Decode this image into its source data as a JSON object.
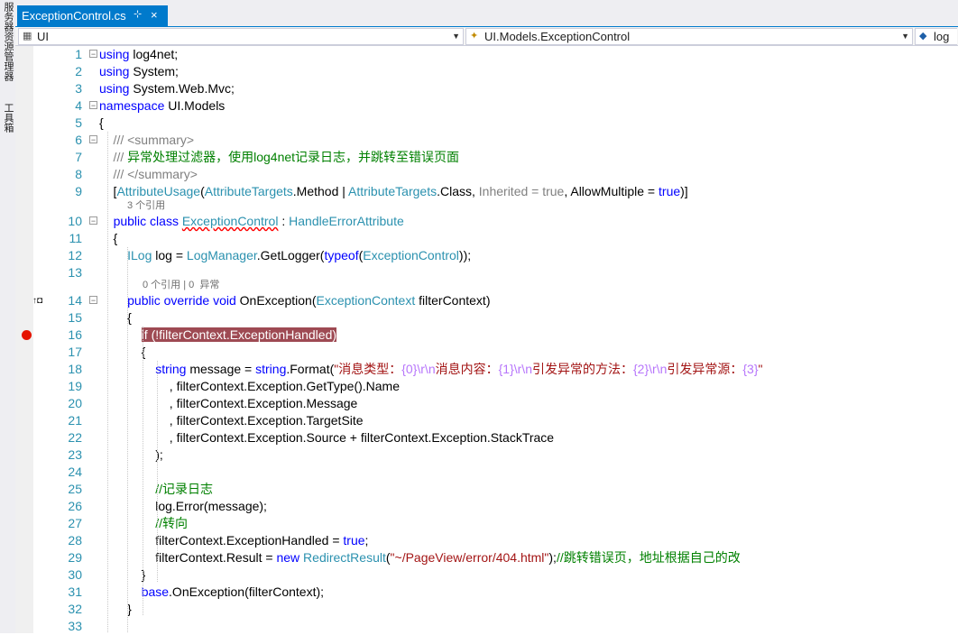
{
  "side_panel": {
    "tabs": [
      "服务器资源管理器",
      "工具箱"
    ]
  },
  "tab": {
    "title": "ExceptionControl.cs",
    "pin_icon": "pin-icon",
    "close_icon": "×"
  },
  "nav": {
    "project": "UI",
    "type": "UI.Models.ExceptionControl",
    "member": "log"
  },
  "lens": {
    "class_refs": "3 个引用",
    "method_refs": "0 个引用 | 0  异常"
  },
  "lines": [
    {
      "n": "1",
      "segs": [
        {
          "t": "using",
          "c": "kw"
        },
        {
          "t": " log4net;",
          "c": "id"
        }
      ]
    },
    {
      "n": "2",
      "segs": [
        {
          "t": "using",
          "c": "kw"
        },
        {
          "t": " System;",
          "c": "id"
        }
      ]
    },
    {
      "n": "3",
      "segs": [
        {
          "t": "using",
          "c": "kw"
        },
        {
          "t": " System.Web.Mvc;",
          "c": "id"
        }
      ]
    },
    {
      "n": "4",
      "segs": [
        {
          "t": "namespace",
          "c": "kw"
        },
        {
          "t": " UI.Models",
          "c": "id"
        }
      ]
    },
    {
      "n": "5",
      "segs": [
        {
          "t": "{",
          "c": "id"
        }
      ]
    },
    {
      "n": "6",
      "segs": [
        {
          "t": "    /// ",
          "c": "gr"
        },
        {
          "t": "<summary>",
          "c": "gr"
        }
      ]
    },
    {
      "n": "7",
      "segs": [
        {
          "t": "    /// ",
          "c": "gr"
        },
        {
          "t": "异常处理过滤器，使用log4net记录日志，并跳转至错误页面",
          "c": "cm"
        }
      ]
    },
    {
      "n": "8",
      "segs": [
        {
          "t": "    /// ",
          "c": "gr"
        },
        {
          "t": "</summary>",
          "c": "gr"
        }
      ]
    },
    {
      "n": "9",
      "segs": [
        {
          "t": "    [",
          "c": "id"
        },
        {
          "t": "AttributeUsage",
          "c": "ty"
        },
        {
          "t": "(",
          "c": "id"
        },
        {
          "t": "AttributeTargets",
          "c": "ty"
        },
        {
          "t": ".Method | ",
          "c": "id"
        },
        {
          "t": "AttributeTargets",
          "c": "ty"
        },
        {
          "t": ".Class, ",
          "c": "id"
        },
        {
          "t": "Inherited = true",
          "c": "gr"
        },
        {
          "t": ", AllowMultiple = ",
          "c": "id"
        },
        {
          "t": "true",
          "c": "kw"
        },
        {
          "t": ")]",
          "c": "id"
        }
      ]
    },
    {
      "n": "10",
      "segs": [
        {
          "t": "    ",
          "c": "id"
        },
        {
          "t": "public",
          "c": "kw"
        },
        {
          "t": " ",
          "c": "id"
        },
        {
          "t": "class",
          "c": "kw"
        },
        {
          "t": " ",
          "c": "id"
        },
        {
          "t": "ExceptionControl",
          "c": "ty sq"
        },
        {
          "t": " : ",
          "c": "id"
        },
        {
          "t": "HandleErrorAttribute",
          "c": "ty"
        }
      ]
    },
    {
      "n": "11",
      "segs": [
        {
          "t": "    {",
          "c": "id"
        }
      ]
    },
    {
      "n": "12",
      "segs": [
        {
          "t": "        ",
          "c": "id"
        },
        {
          "t": "ILog",
          "c": "ty"
        },
        {
          "t": " log = ",
          "c": "id"
        },
        {
          "t": "LogManager",
          "c": "ty"
        },
        {
          "t": ".GetLogger(",
          "c": "id"
        },
        {
          "t": "typeof",
          "c": "kw"
        },
        {
          "t": "(",
          "c": "id"
        },
        {
          "t": "ExceptionControl",
          "c": "ty"
        },
        {
          "t": "));",
          "c": "id"
        }
      ]
    },
    {
      "n": "13",
      "segs": []
    },
    {
      "n": "14",
      "segs": [
        {
          "t": "        ",
          "c": "id"
        },
        {
          "t": "public",
          "c": "kw"
        },
        {
          "t": " ",
          "c": "id"
        },
        {
          "t": "override",
          "c": "kw"
        },
        {
          "t": " ",
          "c": "id"
        },
        {
          "t": "void",
          "c": "kw"
        },
        {
          "t": " OnException(",
          "c": "id"
        },
        {
          "t": "ExceptionContext",
          "c": "ty"
        },
        {
          "t": " filterContext)",
          "c": "id"
        }
      ]
    },
    {
      "n": "15",
      "segs": [
        {
          "t": "        {",
          "c": "id"
        }
      ]
    },
    {
      "n": "16",
      "segs": [
        {
          "t": "            ",
          "c": "id"
        },
        {
          "t": "if (!filterContext.ExceptionHandled)",
          "c": "hl"
        }
      ]
    },
    {
      "n": "17",
      "segs": [
        {
          "t": "            {",
          "c": "id"
        }
      ]
    },
    {
      "n": "18",
      "segs": [
        {
          "t": "                ",
          "c": "id"
        },
        {
          "t": "string",
          "c": "kw"
        },
        {
          "t": " message = ",
          "c": "id"
        },
        {
          "t": "string",
          "c": "kw"
        },
        {
          "t": ".Format(",
          "c": "id"
        },
        {
          "t": "\"消息类型：",
          "c": "st"
        },
        {
          "t": "{0}",
          "c": "es"
        },
        {
          "t": "\\r\\n",
          "c": "es"
        },
        {
          "t": "消息内容：",
          "c": "st"
        },
        {
          "t": "{1}",
          "c": "es"
        },
        {
          "t": "\\r\\n",
          "c": "es"
        },
        {
          "t": "引发异常的方法：",
          "c": "st"
        },
        {
          "t": "{2}",
          "c": "es"
        },
        {
          "t": "\\r\\n",
          "c": "es"
        },
        {
          "t": "引发异常源：",
          "c": "st"
        },
        {
          "t": "{3}",
          "c": "es"
        },
        {
          "t": "\"",
          "c": "st"
        }
      ]
    },
    {
      "n": "19",
      "segs": [
        {
          "t": "                    , filterContext.Exception.GetType().Name",
          "c": "id"
        }
      ]
    },
    {
      "n": "20",
      "segs": [
        {
          "t": "                    , filterContext.Exception.Message",
          "c": "id"
        }
      ]
    },
    {
      "n": "21",
      "segs": [
        {
          "t": "                    , filterContext.Exception.TargetSite",
          "c": "id"
        }
      ]
    },
    {
      "n": "22",
      "segs": [
        {
          "t": "                    , filterContext.Exception.Source + filterContext.Exception.StackTrace",
          "c": "id"
        }
      ]
    },
    {
      "n": "23",
      "segs": [
        {
          "t": "                );",
          "c": "id"
        }
      ]
    },
    {
      "n": "24",
      "segs": []
    },
    {
      "n": "25",
      "segs": [
        {
          "t": "                ",
          "c": "id"
        },
        {
          "t": "//记录日志",
          "c": "cm"
        }
      ]
    },
    {
      "n": "26",
      "segs": [
        {
          "t": "                log.Error(message);",
          "c": "id"
        }
      ]
    },
    {
      "n": "27",
      "segs": [
        {
          "t": "                ",
          "c": "id"
        },
        {
          "t": "//转向",
          "c": "cm"
        }
      ]
    },
    {
      "n": "28",
      "segs": [
        {
          "t": "                filterContext.ExceptionHandled = ",
          "c": "id"
        },
        {
          "t": "true",
          "c": "kw"
        },
        {
          "t": ";",
          "c": "id"
        }
      ]
    },
    {
      "n": "29",
      "segs": [
        {
          "t": "                filterContext.Result = ",
          "c": "id"
        },
        {
          "t": "new",
          "c": "kw"
        },
        {
          "t": " ",
          "c": "id"
        },
        {
          "t": "RedirectResult",
          "c": "ty"
        },
        {
          "t": "(",
          "c": "id"
        },
        {
          "t": "\"~/PageView/error/404.html\"",
          "c": "st"
        },
        {
          "t": ");",
          "c": "id"
        },
        {
          "t": "//跳转错误页，地址根据自己的改",
          "c": "cm"
        }
      ]
    },
    {
      "n": "30",
      "segs": [
        {
          "t": "            }",
          "c": "id"
        }
      ]
    },
    {
      "n": "31",
      "segs": [
        {
          "t": "            ",
          "c": "id"
        },
        {
          "t": "base",
          "c": "kw"
        },
        {
          "t": ".OnException(filterContext);",
          "c": "id"
        }
      ]
    },
    {
      "n": "32",
      "segs": [
        {
          "t": "        }",
          "c": "id"
        }
      ]
    },
    {
      "n": "33",
      "segs": []
    }
  ],
  "colors": {
    "accent": "#007acc",
    "line_number": "#2b91af",
    "breakpoint": "#e51400",
    "highlight": "#9e4a53"
  }
}
